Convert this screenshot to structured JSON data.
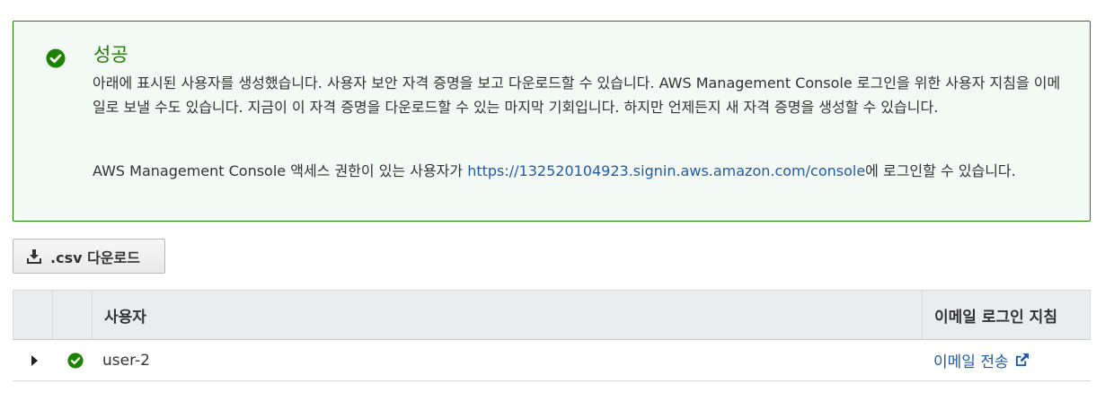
{
  "alert": {
    "title": "성공",
    "body": "아래에 표시된 사용자를 생성했습니다. 사용자 보안 자격 증명을 보고 다운로드할 수 있습니다. AWS Management Console 로그인을 위한 사용자 지침을 이메일로 보낼 수도 있습니다. 지금이 이 자격 증명을 다운로드할 수 있는 마지막 기회입니다. 하지만 언제든지 새 자격 증명을 생성할 수 있습니다.",
    "console_prefix": "AWS Management Console 액세스 권한이 있는 사용자가 ",
    "console_url": "https://132520104923.signin.aws.amazon.com/console",
    "console_suffix": "에 로그인할 수 있습니다.",
    "icon": "check-circle-icon",
    "color": "#1d8102"
  },
  "download_button": {
    "label": ".csv 다운로드",
    "icon": "download-icon"
  },
  "table": {
    "headers": [
      "",
      "",
      "사용자",
      "이메일 로그인 지침"
    ],
    "rows": [
      {
        "status_icon": "check-circle-icon",
        "user": "user-2",
        "email_action": "이메일 전송",
        "email_icon": "external-link-icon"
      }
    ]
  }
}
